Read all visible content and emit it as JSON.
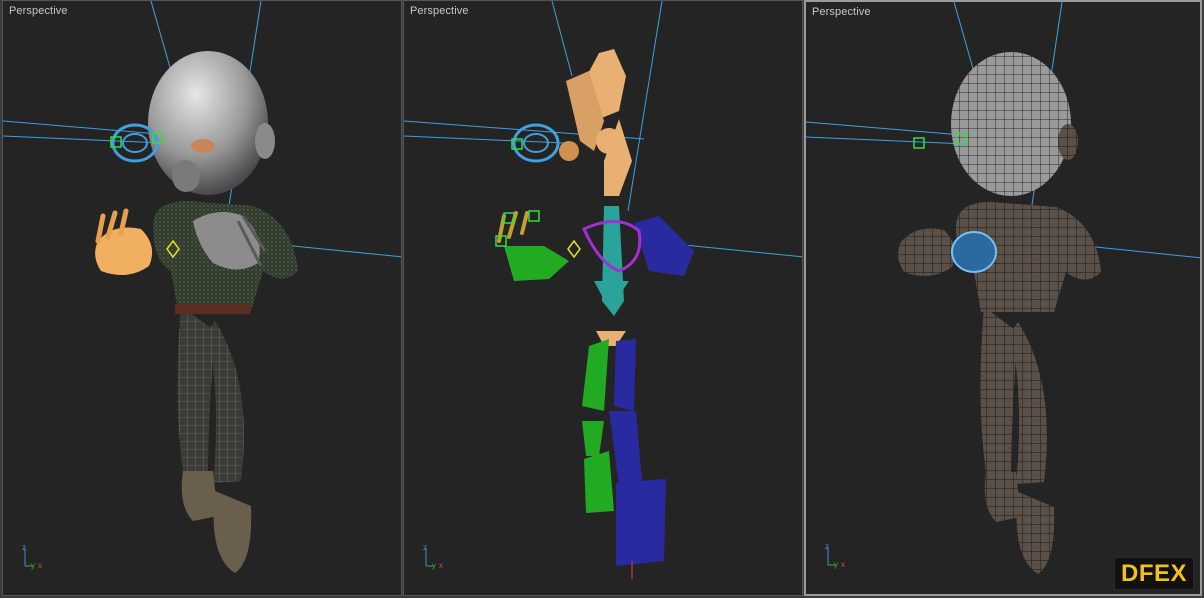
{
  "viewports": [
    {
      "label": "Perspective",
      "mode": "shaded-mesh"
    },
    {
      "label": "Perspective",
      "mode": "skeleton-rig"
    },
    {
      "label": "Perspective",
      "mode": "wireframe-shaded"
    }
  ],
  "axis_labels": {
    "x": "x",
    "y": "y",
    "z": "z"
  },
  "watermark": {
    "text": "DFEX"
  },
  "colors": {
    "viewport_bg": "#242424",
    "gizmo_blue": "#3fa0e0",
    "control_green": "#33dd44",
    "bone_orange": "#e8b072",
    "bone_green": "#22aa22",
    "bone_blue": "#2a2aa0",
    "logo": "#f2c21a"
  }
}
